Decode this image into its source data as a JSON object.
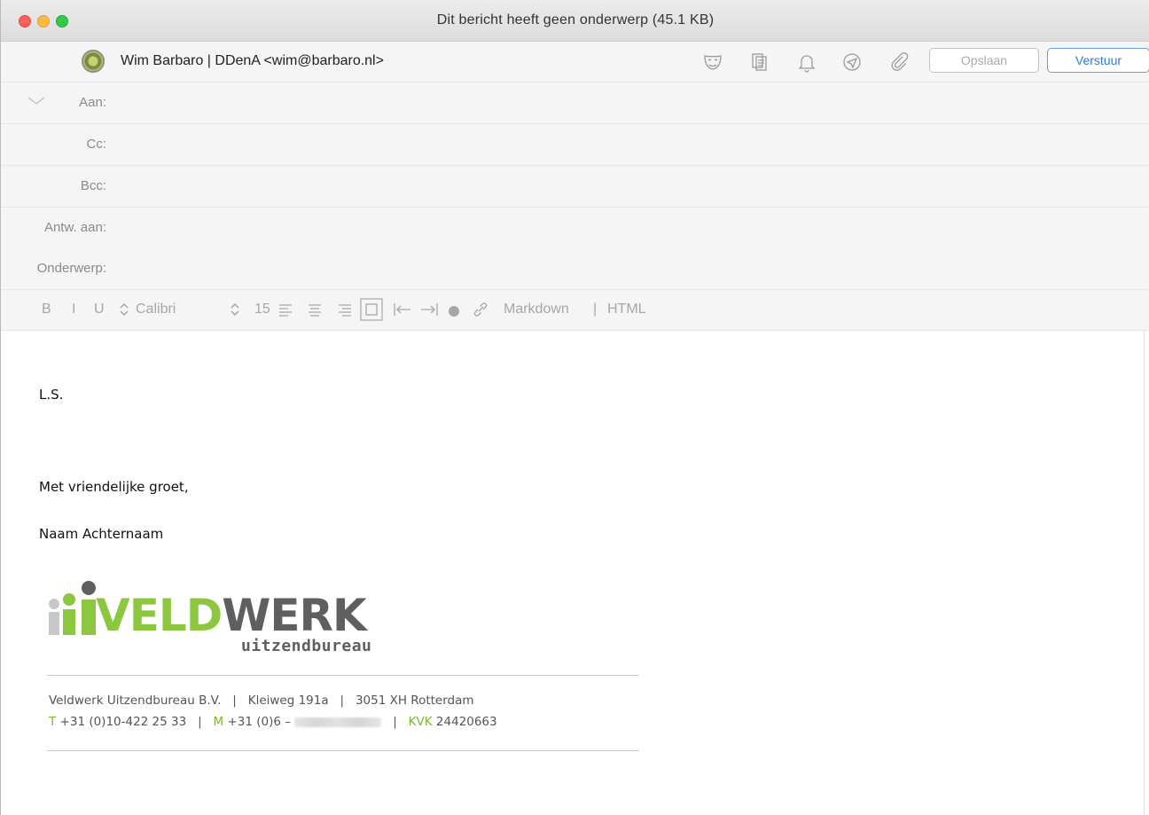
{
  "window": {
    "title": "Dit bericht heeft geen onderwerp (45.1 KB)"
  },
  "from": {
    "text": "Wim Barbaro  |  DDenA <wim@barbaro.nl>"
  },
  "toolbar": {
    "icons": [
      "mask-icon",
      "template-icon",
      "bell-icon",
      "send-later-icon",
      "paperclip-icon"
    ],
    "save_label": "Opslaan",
    "send_label": "Verstuur"
  },
  "fields": {
    "to_label": "Aan:",
    "cc_label": "Cc:",
    "bcc_label": "Bcc:",
    "reply_to_label": "Antw. aan:",
    "subject_label": "Onderwerp:",
    "to_value": "",
    "cc_value": "",
    "bcc_value": "",
    "reply_to_value": "",
    "subject_value": ""
  },
  "format": {
    "bold": "B",
    "italic": "I",
    "underline": "U",
    "font": "Calibri",
    "size": "15",
    "markdown": "Markdown",
    "separator": "|",
    "html": "HTML"
  },
  "body": {
    "greeting": "L.S.",
    "closing": "Met vriendelijke groet,",
    "name": "Naam Achternaam"
  },
  "signature": {
    "logo_word_1": "VELD",
    "logo_word_2": "WERK",
    "logo_sub": "uitzendbureau",
    "company": "Veldwerk Uitzendbureau B.V.",
    "address": "Kleiweg 191a",
    "city": "3051 XH Rotterdam",
    "sep": "|",
    "t_label": "T",
    "t_value": "+31 (0)10-422 25 33",
    "m_label": "M",
    "m_value": "+31 (0)6 –",
    "kvk_label": "KVK",
    "kvk_value": "24420663",
    "brand_green": "#8dc63f",
    "brand_grey": "#5f5f5f"
  }
}
